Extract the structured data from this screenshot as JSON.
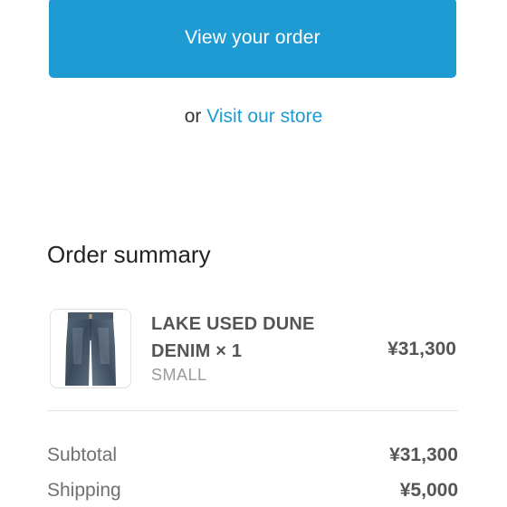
{
  "actions": {
    "view_order_label": "View your order",
    "or_text": "or",
    "visit_store_label": "Visit our store"
  },
  "order_summary": {
    "title": "Order summary",
    "items": [
      {
        "name": "LAKE USED DUNE DENIM × 1",
        "variant": "SMALL",
        "price": "¥31,300",
        "image": "jeans-thumbnail"
      }
    ],
    "subtotal_label": "Subtotal",
    "subtotal_value": "¥31,300",
    "shipping_label": "Shipping",
    "shipping_value": "¥5,000"
  },
  "colors": {
    "accent": "#1e9bd2",
    "text": "#333333",
    "muted": "#9a9a9a"
  }
}
